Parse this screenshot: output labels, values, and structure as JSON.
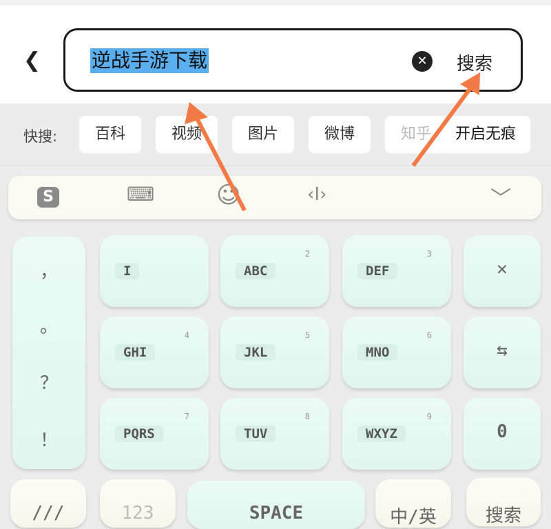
{
  "header": {
    "back_icon": "chevron-left-icon",
    "query": "逆战手游下载",
    "clear_icon": "clear-circle-icon",
    "search_label": "搜索"
  },
  "quick": {
    "label": "快搜:",
    "chips": [
      "百科",
      "视频",
      "图片",
      "微博",
      "知乎",
      "开启无痕"
    ]
  },
  "toolbar": {
    "icons": [
      "sogou-logo-icon",
      "keyboard-icon",
      "emoji-icon",
      "cursor-icon",
      "chevron-down-icon"
    ]
  },
  "keyboard": {
    "punct": [
      "，",
      "。",
      "？",
      "！"
    ],
    "keys": [
      {
        "label": "I",
        "num": ""
      },
      {
        "label": "ABC",
        "num": "2"
      },
      {
        "label": "DEF",
        "num": "3"
      },
      {
        "label": "GHI",
        "num": "4"
      },
      {
        "label": "JKL",
        "num": "5"
      },
      {
        "label": "MNO",
        "num": "6"
      },
      {
        "label": "PQRS",
        "num": "7"
      },
      {
        "label": "TUV",
        "num": "8"
      },
      {
        "label": "WXYZ",
        "num": "9"
      }
    ],
    "side": [
      "✕",
      "⇆",
      "0"
    ],
    "bottom": [
      "///",
      "123",
      "SPACE",
      "中/英",
      "搜索"
    ]
  },
  "annotation_color": "#f47a45"
}
